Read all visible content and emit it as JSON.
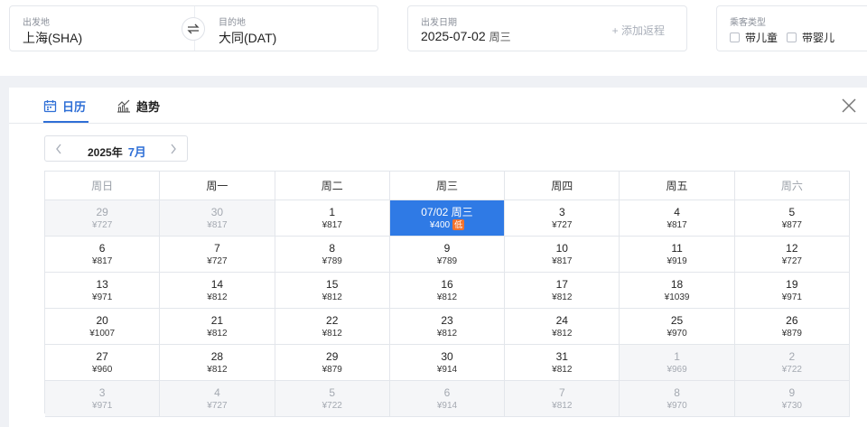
{
  "search": {
    "from_label": "出发地",
    "from_value": "上海(SHA)",
    "to_label": "目的地",
    "to_value": "大同(DAT)",
    "date_label": "出发日期",
    "date_value": "2025-07-02",
    "date_weekday": "周三",
    "return_link": "+ 添加返程",
    "pax_label": "乘客类型",
    "pax_child": "带儿童",
    "pax_infant": "带婴儿"
  },
  "tabs": {
    "calendar": "日历",
    "trend": "趋势"
  },
  "month_nav": {
    "year": "2025年",
    "month": "7月"
  },
  "colors": {
    "accent": "#2f6fd6",
    "selected": "#2f7ae5",
    "low_badge": "#f3722c"
  },
  "calendar": {
    "weekdays": [
      "周日",
      "周一",
      "周二",
      "周三",
      "周四",
      "周五",
      "周六"
    ],
    "weeks": [
      [
        {
          "day": "29",
          "price": "¥727",
          "other": true
        },
        {
          "day": "30",
          "price": "¥817",
          "other": true
        },
        {
          "day": "1",
          "price": "¥817"
        },
        {
          "day": "07/02 周三",
          "price": "¥400",
          "selected": true,
          "badge": "低"
        },
        {
          "day": "3",
          "price": "¥727"
        },
        {
          "day": "4",
          "price": "¥817"
        },
        {
          "day": "5",
          "price": "¥877"
        }
      ],
      [
        {
          "day": "6",
          "price": "¥817"
        },
        {
          "day": "7",
          "price": "¥727"
        },
        {
          "day": "8",
          "price": "¥789"
        },
        {
          "day": "9",
          "price": "¥789"
        },
        {
          "day": "10",
          "price": "¥817"
        },
        {
          "day": "11",
          "price": "¥919"
        },
        {
          "day": "12",
          "price": "¥727"
        }
      ],
      [
        {
          "day": "13",
          "price": "¥971"
        },
        {
          "day": "14",
          "price": "¥812"
        },
        {
          "day": "15",
          "price": "¥812"
        },
        {
          "day": "16",
          "price": "¥812"
        },
        {
          "day": "17",
          "price": "¥812"
        },
        {
          "day": "18",
          "price": "¥1039"
        },
        {
          "day": "19",
          "price": "¥971"
        }
      ],
      [
        {
          "day": "20",
          "price": "¥1007"
        },
        {
          "day": "21",
          "price": "¥812"
        },
        {
          "day": "22",
          "price": "¥812"
        },
        {
          "day": "23",
          "price": "¥812"
        },
        {
          "day": "24",
          "price": "¥812"
        },
        {
          "day": "25",
          "price": "¥970"
        },
        {
          "day": "26",
          "price": "¥879"
        }
      ],
      [
        {
          "day": "27",
          "price": "¥960"
        },
        {
          "day": "28",
          "price": "¥812"
        },
        {
          "day": "29",
          "price": "¥879"
        },
        {
          "day": "30",
          "price": "¥914"
        },
        {
          "day": "31",
          "price": "¥812"
        },
        {
          "day": "1",
          "price": "¥969",
          "other": true
        },
        {
          "day": "2",
          "price": "¥722",
          "other": true
        }
      ],
      [
        {
          "day": "3",
          "price": "¥971",
          "other": true
        },
        {
          "day": "4",
          "price": "¥727",
          "other": true
        },
        {
          "day": "5",
          "price": "¥722",
          "other": true
        },
        {
          "day": "6",
          "price": "¥914",
          "other": true
        },
        {
          "day": "7",
          "price": "¥812",
          "other": true
        },
        {
          "day": "8",
          "price": "¥970",
          "other": true
        },
        {
          "day": "9",
          "price": "¥730",
          "other": true
        }
      ]
    ]
  }
}
